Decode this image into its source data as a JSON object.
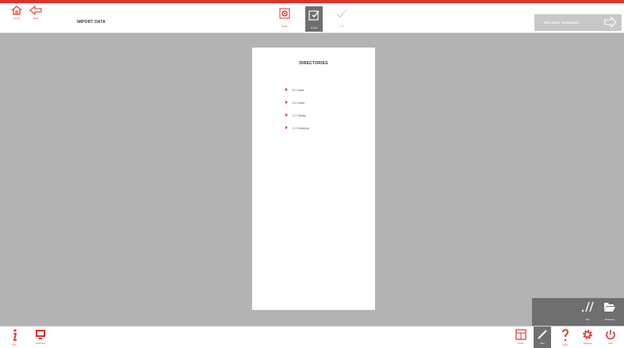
{
  "colors": {
    "accent": "#e0322c",
    "panel_gray": "#6f6f6f",
    "canvas": "#b3b3b3"
  },
  "header": {
    "home_label": "Home",
    "back_label": "Back",
    "title": "IMPORT DATA",
    "modes": [
      {
        "label": "Setup",
        "icon": "setup-icon",
        "state": "inactive"
      },
      {
        "label": "Import",
        "icon": "import-icon",
        "state": "active"
      },
      {
        "label": "Verify",
        "icon": "verify-icon",
        "state": "disabled"
      }
    ],
    "summary_label": "PROJECT SUMMARY"
  },
  "panel": {
    "title": "DIRECTORIES",
    "items": [
      "E:\\ Data",
      "D:\\ Data",
      "C:\\ Sticky",
      "C:\\ Desktop"
    ]
  },
  "flyout": {
    "items": [
      {
        "label": "File",
        "icon": "file-path-icon"
      },
      {
        "label": "Directory",
        "icon": "folder-open-icon"
      }
    ]
  },
  "footer": {
    "left": [
      {
        "label": "Info",
        "icon": "info-icon"
      },
      {
        "label": "Overview",
        "icon": "screen-icon"
      }
    ],
    "right": [
      {
        "label": "Close",
        "icon": "close-panel-icon"
      },
      {
        "label": "Edit",
        "icon": "pencil-icon",
        "state": "active"
      },
      {
        "label": "Help",
        "icon": "help-icon"
      },
      {
        "label": "Settings",
        "icon": "settings-icon"
      },
      {
        "label": "Exit",
        "icon": "power-icon"
      }
    ]
  }
}
